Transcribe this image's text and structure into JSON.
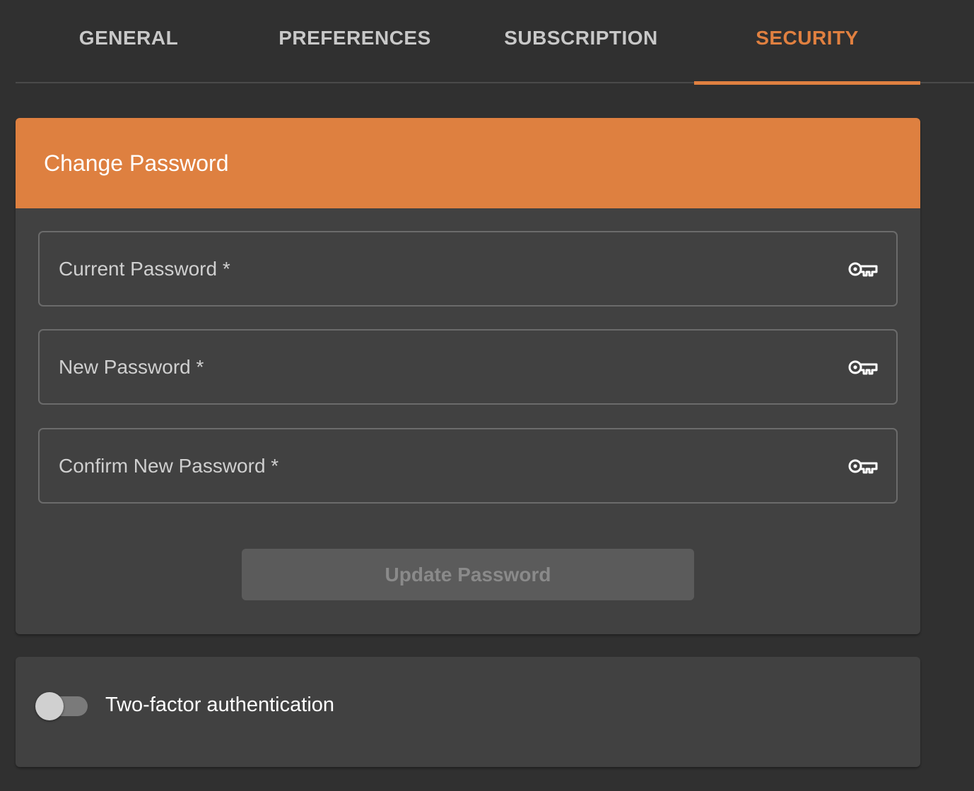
{
  "tabs": [
    {
      "label": "GENERAL",
      "active": false
    },
    {
      "label": "PREFERENCES",
      "active": false
    },
    {
      "label": "SUBSCRIPTION",
      "active": false
    },
    {
      "label": "SECURITY",
      "active": true
    }
  ],
  "change_password": {
    "title": "Change Password",
    "fields": [
      {
        "label": "Current Password *",
        "value": "",
        "icon": "key-icon"
      },
      {
        "label": "New Password *",
        "value": "",
        "icon": "key-icon"
      },
      {
        "label": "Confirm New Password *",
        "value": "",
        "icon": "key-icon"
      }
    ],
    "submit_label": "Update Password",
    "submit_enabled": false
  },
  "two_factor": {
    "label": "Two-factor authentication",
    "enabled": false
  },
  "colors": {
    "accent": "#de8040",
    "background": "#303030",
    "card": "#414141"
  }
}
